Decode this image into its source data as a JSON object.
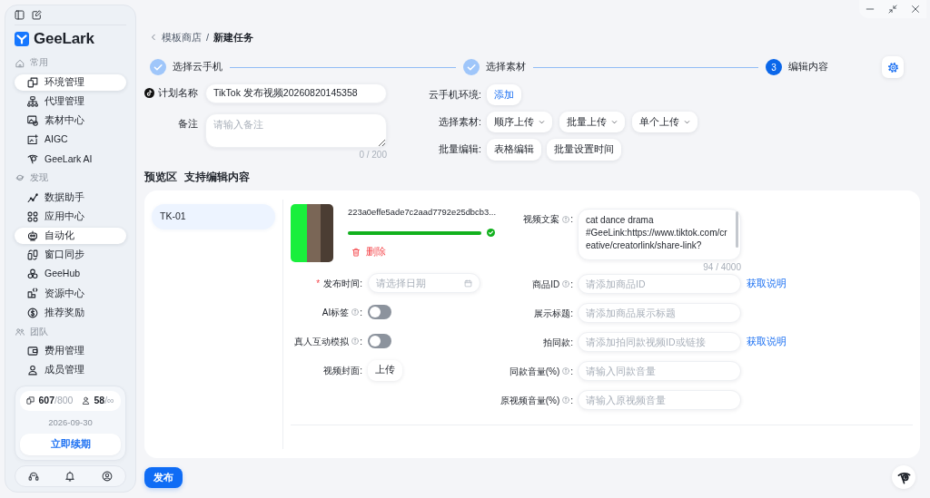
{
  "sidebar": {
    "brand": "GeeLark",
    "sections": [
      {
        "title": "常用",
        "items": [
          {
            "label": "环境管理",
            "selected": true
          },
          {
            "label": "代理管理",
            "selected": false
          },
          {
            "label": "素材中心",
            "selected": false
          },
          {
            "label": "AIGC",
            "selected": false
          },
          {
            "label": "GeeLark AI",
            "selected": false
          }
        ]
      },
      {
        "title": "发现",
        "items": [
          {
            "label": "数据助手",
            "selected": false
          },
          {
            "label": "应用中心",
            "selected": false
          },
          {
            "label": "自动化",
            "selected": true
          },
          {
            "label": "窗口同步",
            "selected": false
          },
          {
            "label": "GeeHub",
            "selected": false
          },
          {
            "label": "资源中心",
            "selected": false
          },
          {
            "label": "推荐奖励",
            "selected": false
          }
        ]
      },
      {
        "title": "团队",
        "items": [
          {
            "label": "费用管理",
            "selected": false
          },
          {
            "label": "成员管理",
            "selected": false
          }
        ]
      }
    ],
    "quota": {
      "devices_used": "607",
      "devices_limit": "/800",
      "members_used": "58",
      "members_limit": "/∞"
    },
    "expiry": "2026-09-30",
    "renew_button": "立即续期"
  },
  "breadcrumb": {
    "parent": "模板商店",
    "separator": "/",
    "current": "新建任务"
  },
  "steps": [
    {
      "label": "选择云手机",
      "done": true
    },
    {
      "label": "选择素材",
      "done": true
    },
    {
      "label": "编辑内容",
      "done": false,
      "number": "3"
    }
  ],
  "task_form": {
    "plan_name": {
      "label": "计划名称",
      "value": "TikTok 发布视频20260820145358"
    },
    "note": {
      "label": "备注",
      "placeholder": "请输入备注",
      "counter": "0 / 200"
    },
    "phone_env": {
      "label": "云手机环境:",
      "button": "添加"
    },
    "material": {
      "label": "选择素材:",
      "dropdowns": [
        "顺序上传",
        "批量上传",
        "单个上传"
      ]
    },
    "batch_edit": {
      "label": "批量编辑:",
      "buttons": [
        "表格编辑",
        "批量设置时间"
      ]
    }
  },
  "preview": {
    "title": "预览区",
    "subtitle": "支持编辑内容",
    "accounts": [
      {
        "label": "TK-01",
        "selected": true
      }
    ],
    "video": {
      "filename": "223a0effe5ade7c2aad7792e25dbcb3...",
      "upload": {
        "level": 1
      },
      "delete": "删除"
    },
    "left_fields": [
      {
        "kind": "date",
        "required_mark": "*",
        "label": "发布时间:",
        "info": false,
        "placeholder": "请选择日期"
      },
      {
        "kind": "toggle",
        "label": "AI标签",
        "info": true,
        "colon": ":",
        "on": false
      },
      {
        "kind": "toggle",
        "label": "真人互动模拟",
        "info": true,
        "colon": ":",
        "on": false
      },
      {
        "kind": "upload",
        "label": "视频封面:",
        "info": false,
        "button": "上传"
      }
    ],
    "right_fields": [
      {
        "kind": "textarea",
        "label": "视频文案",
        "info": true,
        "colon": ":",
        "value": "cat dance drama\n#GeeLink:https://www.tiktok.com/creative/creatorlink/share-link?",
        "counter": "94 / 4000"
      },
      {
        "kind": "input",
        "label": "商品ID",
        "info": true,
        "colon": ":",
        "placeholder": "请添加商品ID",
        "link": "获取说明"
      },
      {
        "kind": "input",
        "label": "展示标题:",
        "info": false,
        "placeholder": "请添加商品展示标题"
      },
      {
        "kind": "input",
        "label": "拍同款:",
        "info": false,
        "placeholder": "请添加拍同款视频ID或链接",
        "link": "获取说明"
      },
      {
        "kind": "input",
        "label": "同款音量(%)",
        "info": true,
        "colon": ":",
        "placeholder": "请输入同款音量"
      },
      {
        "kind": "input",
        "label": "原视频音量(%)",
        "info": true,
        "colon": ":",
        "placeholder": "请输入原视频音量"
      }
    ]
  },
  "publish_button": "发布"
}
